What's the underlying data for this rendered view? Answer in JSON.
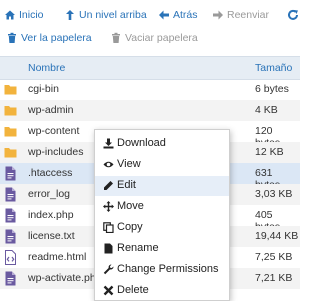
{
  "toolbar": {
    "home": "Inicio",
    "up": "Un nivel arriba",
    "back": "Atrás",
    "forward": "Reenviar",
    "show_trash": "Ver la papelera",
    "empty_trash": "Vaciar papelera"
  },
  "table": {
    "col_name": "Nombre",
    "col_size": "Tamaño",
    "rows": [
      {
        "name": "cgi-bin",
        "size": "6 bytes",
        "type": "folder"
      },
      {
        "name": "wp-admin",
        "size": "4 KB",
        "type": "folder"
      },
      {
        "name": "wp-content",
        "size": "120 bytes",
        "type": "folder"
      },
      {
        "name": "wp-includes",
        "size": "12 KB",
        "type": "folder"
      },
      {
        "name": ".htaccess",
        "size": "631 bytes",
        "type": "file",
        "selected": true
      },
      {
        "name": "error_log",
        "size": "3,03 KB",
        "type": "file"
      },
      {
        "name": "index.php",
        "size": "405 bytes",
        "type": "file"
      },
      {
        "name": "license.txt",
        "size": "19,44 KB",
        "type": "file"
      },
      {
        "name": "readme.html",
        "size": "7,25 KB",
        "type": "html"
      },
      {
        "name": "wp-activate.php",
        "size": "7,21 KB",
        "type": "file"
      }
    ]
  },
  "context_menu": {
    "items": [
      {
        "label": "Download",
        "icon": "download-icon"
      },
      {
        "label": "View",
        "icon": "eye-icon"
      },
      {
        "label": "Edit",
        "icon": "pencil-icon"
      },
      {
        "label": "Move",
        "icon": "move-icon"
      },
      {
        "label": "Copy",
        "icon": "copy-icon"
      },
      {
        "label": "Rename",
        "icon": "rename-icon"
      },
      {
        "label": "Change Permissions",
        "icon": "wrench-icon"
      },
      {
        "label": "Delete",
        "icon": "close-icon"
      }
    ]
  },
  "colors": {
    "accent": "#2a73b8",
    "folder": "#f2b33d",
    "file": "#6a5aa0",
    "header_bg": "#e6edf4",
    "selected_row": "#dbe7f5"
  }
}
